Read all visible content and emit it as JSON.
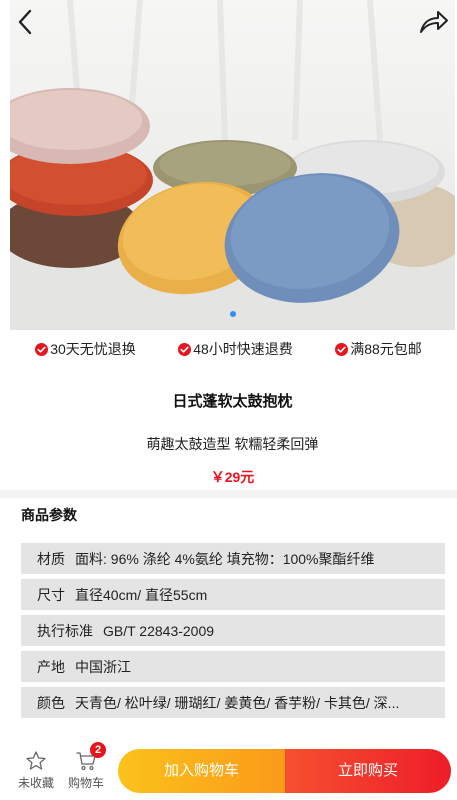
{
  "product": {
    "title": "日式蓬软太鼓抱枕",
    "subtitle": "萌趣太鼓造型 软糯轻柔回弹",
    "price": "￥29元"
  },
  "gallery": {
    "total_images": 1,
    "active_index": 0,
    "accent_color": "#2f8ff5"
  },
  "guarantees": [
    {
      "label": "30天无忧退换"
    },
    {
      "label": "48小时快速退费"
    },
    {
      "label": "满88元包邮"
    }
  ],
  "params": {
    "heading": "商品参数",
    "rows": [
      {
        "label": "材质",
        "value": "面料: 96% 涤纶 4%氨纶 填充物：100%聚酯纤维"
      },
      {
        "label": "尺寸",
        "value": "直径40cm/ 直径55cm"
      },
      {
        "label": "执行标准",
        "value": "GB/T 22843-2009"
      },
      {
        "label": "产地",
        "value": "中国浙江"
      },
      {
        "label": "颜色",
        "value": "天青色/ 松叶绿/ 珊瑚红/ 姜黄色/ 香芋粉/ 卡其色/ 深..."
      }
    ]
  },
  "bottom_bar": {
    "favorite_label": "未收藏",
    "cart_label": "购物车",
    "cart_count": "2",
    "add_to_cart_label": "加入购物车",
    "buy_now_label": "立即购买"
  },
  "colors": {
    "price_red": "#e8141e",
    "add_gradient": [
      "#fbc21a",
      "#fb9a1a"
    ],
    "buy_gradient": [
      "#f6502f",
      "#ee1c2a"
    ]
  }
}
